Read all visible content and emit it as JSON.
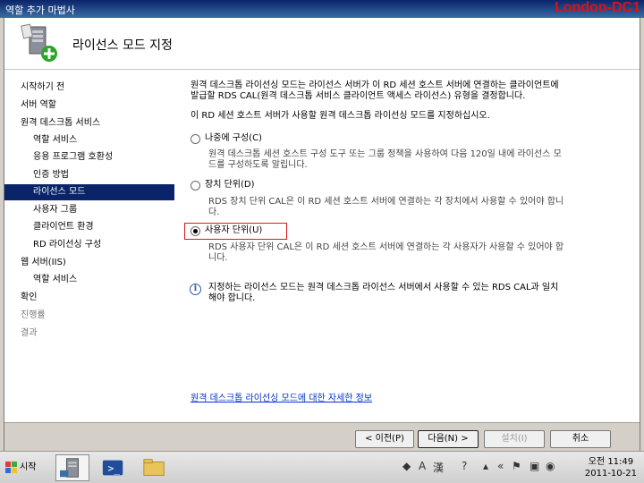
{
  "titlebar": {
    "title": "역할 추가 마법사",
    "host_label": "London-DC1"
  },
  "header": {
    "heading": "라이선스 모드 지정"
  },
  "nav": {
    "items": [
      {
        "label": "시작하기 전",
        "level": 0,
        "state": "normal"
      },
      {
        "label": "서버 역할",
        "level": 0,
        "state": "normal"
      },
      {
        "label": "원격 데스크톱 서비스",
        "level": 0,
        "state": "normal"
      },
      {
        "label": "역할 서비스",
        "level": 1,
        "state": "normal"
      },
      {
        "label": "응용 프로그램 호환성",
        "level": 1,
        "state": "normal"
      },
      {
        "label": "인증 방법",
        "level": 1,
        "state": "normal"
      },
      {
        "label": "라이선스 모드",
        "level": 1,
        "state": "selected"
      },
      {
        "label": "사용자 그룹",
        "level": 1,
        "state": "normal"
      },
      {
        "label": "클라이언트 환경",
        "level": 1,
        "state": "normal"
      },
      {
        "label": "RD 라이선싱 구성",
        "level": 1,
        "state": "normal"
      },
      {
        "label": "웹 서버(IIS)",
        "level": 0,
        "state": "normal"
      },
      {
        "label": "역할 서비스",
        "level": 1,
        "state": "normal"
      },
      {
        "label": "확인",
        "level": 0,
        "state": "normal"
      },
      {
        "label": "진행률",
        "level": 0,
        "state": "disabled"
      },
      {
        "label": "결과",
        "level": 0,
        "state": "disabled"
      }
    ]
  },
  "content": {
    "intro_line1": "원격 데스크톱 라이선싱 모드는 라이선스 서버가 이 RD 세션 호스트 서버에 연결하는 클라이언트에",
    "intro_line2": "발급할 RDS CAL(원격 데스크톱 서비스 클라이언트 액세스 라이선스) 유형을 결정합니다.",
    "instruction": "이 RD 세션 호스트 서버가 사용할 원격 데스크톱 라이선싱 모드를 지정하십시오.",
    "options": [
      {
        "label": "나중에 구성(C)",
        "checked": false,
        "desc1": "원격 데스크톱 세션 호스트 구성 도구 또는 그룹 정책을 사용하여 다음 120일 내에 라이선스 모",
        "desc2": "드를 구성하도록 알립니다."
      },
      {
        "label": "장치 단위(D)",
        "checked": false,
        "desc1": "RDS 장치 단위 CAL은 이 RD 세션 호스트 서버에 연결하는 각 장치에서 사용할 수 있어야 합니",
        "desc2": "다."
      },
      {
        "label": "사용자 단위(U)",
        "checked": true,
        "desc1": "RDS 사용자 단위 CAL은 이 RD 세션 호스트 서버에 연결하는 각 사용자가 사용할 수 있어야 합",
        "desc2": "니다."
      }
    ],
    "info_line1": "지정하는 라이선스 모드는 원격 데스크톱 라이선스 서버에서 사용할 수 있는 RDS CAL과 일치",
    "info_line2": "해야 합니다.",
    "link": "원격 데스크톱 라이선싱 모드에 대한 자세한 정보"
  },
  "footer": {
    "back": "< 이전(P)",
    "next": "다음(N) >",
    "install": "설치(I)",
    "cancel": "취소"
  },
  "taskbar": {
    "start": "시작",
    "tray_a": "A",
    "tray_han": "漢",
    "clock_time": "오전 11:49",
    "clock_date": "2011-10-21"
  }
}
